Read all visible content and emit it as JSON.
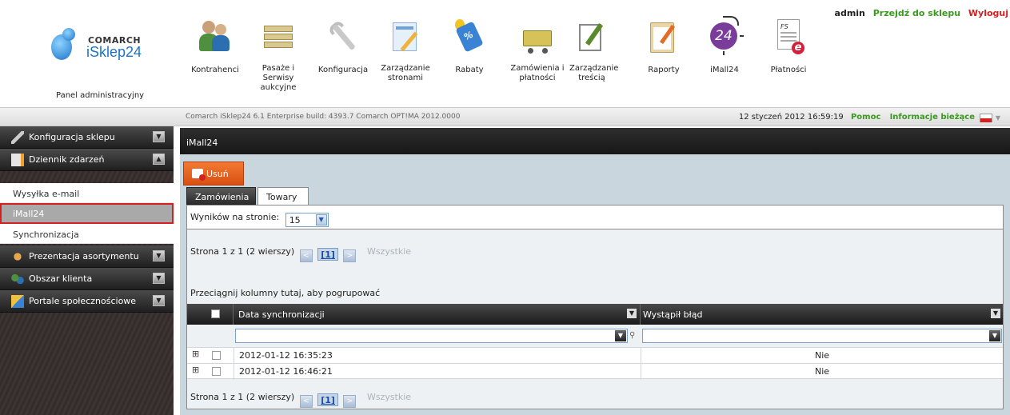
{
  "user": {
    "name": "admin",
    "shop_link": "Przejdź do sklepu",
    "logout": "Wyloguj"
  },
  "logo": {
    "brand": "COMARCH",
    "product": "iSklep24"
  },
  "panel_label": "Panel administracyjny",
  "nav": [
    {
      "label": "Kontrahenci",
      "icon": "people-icon"
    },
    {
      "label": "Pasaże i Serwisy aukcyjne",
      "icon": "archive-icon"
    },
    {
      "label": "Konfiguracja",
      "icon": "wrench-icon"
    },
    {
      "label": "Zarządzanie stronami",
      "icon": "page-edit-icon"
    },
    {
      "label": "Rabaty",
      "icon": "discount-tag-icon"
    },
    {
      "label": "Zamówienia i płatności",
      "icon": "cart-icon"
    },
    {
      "label": "Zarządzanie treścią",
      "icon": "note-edit-icon"
    },
    {
      "label": "Raporty",
      "icon": "clipboard-icon"
    },
    {
      "label": "iMall24",
      "icon": "imall24-icon"
    },
    {
      "label": "Płatności",
      "icon": "invoice-icon"
    }
  ],
  "infobar": {
    "build": "Comarch iSklep24 6.1 Enterprise build: 4393.7 Comarch OPT!MA 2012.0000",
    "datetime": "12 styczeń 2012 16:59:19",
    "help": "Pomoc",
    "news": "Informacje bieżące"
  },
  "sidebar": {
    "sections": [
      {
        "label": "Konfiguracja sklepu",
        "icon": "wrench-icon",
        "toggle": "expand"
      },
      {
        "label": "Dziennik zdarzeń",
        "icon": "journal-icon",
        "toggle": "collapse"
      },
      {
        "label": "Prezentacja asortymentu",
        "icon": "products-icon",
        "toggle": "expand"
      },
      {
        "label": "Obszar klienta",
        "icon": "clients-icon",
        "toggle": "expand"
      },
      {
        "label": "Portale społecznościowe",
        "icon": "social-icon",
        "toggle": "expand"
      }
    ],
    "items": [
      "Wysyłka e-mail",
      "iMall24",
      "Synchronizacja"
    ],
    "active_item": "iMall24"
  },
  "content": {
    "title": "iMall24",
    "delete_button": "Usuń",
    "tabs": [
      "Zamówienia",
      "Towary"
    ],
    "active_tab": "Towary",
    "page_size_label": "Wyników na stronie:",
    "page_size": "15",
    "pager": {
      "text": "Strona 1 z 1 (2 wierszy)",
      "current": "[1]",
      "all": "Wszystkie"
    },
    "group_hint": "Przeciągnij kolumny tutaj, aby pogrupować",
    "columns": [
      "Data synchronizacji",
      "Wystąpił błąd"
    ],
    "rows": [
      {
        "date": "2012-01-12 16:35:23",
        "error": "Nie"
      },
      {
        "date": "2012-01-12 16:46:21",
        "error": "Nie"
      }
    ]
  },
  "colors": {
    "accent_green": "#3a9a1f",
    "logout_red": "#d42020",
    "delete_orange": "#e8621f",
    "brand_blue": "#1a74c9"
  }
}
